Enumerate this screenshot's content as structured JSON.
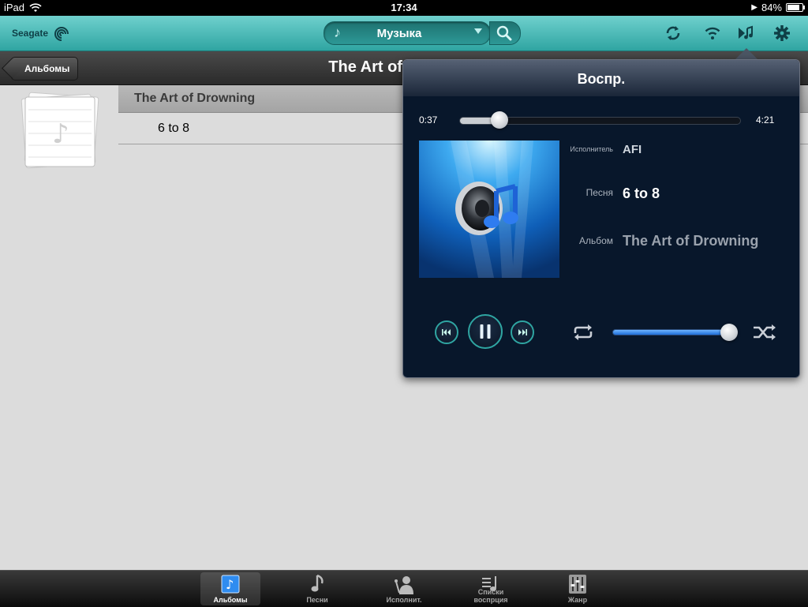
{
  "status_bar": {
    "device": "iPad",
    "time": "17:34",
    "battery": "84%",
    "battery_level": 0.84
  },
  "toolbar": {
    "brand": "Seagate",
    "media_type": "Музыка"
  },
  "nav": {
    "back_label": "Альбомы",
    "title": "The Art of Drowning"
  },
  "content": {
    "section_title": "The Art of Drowning",
    "tracks": [
      "6 to 8"
    ]
  },
  "player": {
    "title": "Воспр.",
    "elapsed": "0:37",
    "duration": "4:21",
    "progress": 0.142,
    "volume": 0.99,
    "artist_label": "Исполнитель",
    "artist": "AFI",
    "song_label": "Песня",
    "song": "6 to 8",
    "album_label": "Альбом",
    "album": "The Art of Drowning"
  },
  "tabs": [
    {
      "label": "Альбомы",
      "active": true
    },
    {
      "label": "Песни",
      "active": false
    },
    {
      "label": "Исполнит.",
      "active": false
    },
    {
      "label": "Списки воспрция",
      "active": false
    },
    {
      "label": "Жанр",
      "active": false
    }
  ],
  "colors": {
    "accent": "#2fa5a2",
    "popover_bg": "#08172b",
    "content_bg": "#dcdcdc"
  }
}
